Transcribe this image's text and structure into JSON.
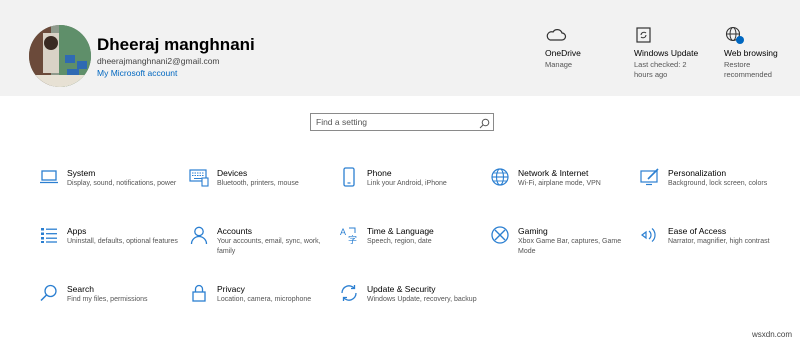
{
  "user": {
    "name": "Dheeraj manghnani",
    "email": "dheerajmanghnani2@gmail.com",
    "account_link": "My Microsoft account"
  },
  "status": [
    {
      "icon": "cloud-icon",
      "title": "OneDrive",
      "sub": "Manage"
    },
    {
      "icon": "windows-update-icon",
      "title": "Windows Update",
      "sub": "Last checked: 2 hours ago"
    },
    {
      "icon": "globe-icon",
      "title": "Web browsing",
      "sub": "Restore recommended"
    }
  ],
  "search": {
    "placeholder": "Find a setting"
  },
  "tiles": [
    {
      "icon": "laptop-icon",
      "title": "System",
      "desc": "Display, sound, notifications, power"
    },
    {
      "icon": "keyboard-icon",
      "title": "Devices",
      "desc": "Bluetooth, printers, mouse"
    },
    {
      "icon": "phone-icon",
      "title": "Phone",
      "desc": "Link your Android, iPhone"
    },
    {
      "icon": "globe-icon",
      "title": "Network & Internet",
      "desc": "Wi-Fi, airplane mode, VPN"
    },
    {
      "icon": "personalization-icon",
      "title": "Personalization",
      "desc": "Background, lock screen, colors"
    },
    {
      "icon": "apps-list-icon",
      "title": "Apps",
      "desc": "Uninstall, defaults, optional features"
    },
    {
      "icon": "person-icon",
      "title": "Accounts",
      "desc": "Your accounts, email, sync, work, family"
    },
    {
      "icon": "language-icon",
      "title": "Time & Language",
      "desc": "Speech, region, date"
    },
    {
      "icon": "xbox-icon",
      "title": "Gaming",
      "desc": "Xbox Game Bar, captures, Game Mode"
    },
    {
      "icon": "ease-of-access-icon",
      "title": "Ease of Access",
      "desc": "Narrator, magnifier, high contrast"
    },
    {
      "icon": "search-icon",
      "title": "Search",
      "desc": "Find my files, permissions"
    },
    {
      "icon": "lock-icon",
      "title": "Privacy",
      "desc": "Location, camera, microphone"
    },
    {
      "icon": "update-icon",
      "title": "Update & Security",
      "desc": "Windows Update, recovery, backup"
    }
  ],
  "watermark": "wsxdn.com",
  "colors": {
    "accent": "#0067c0",
    "icon_blue": "#2b7fd1",
    "header_bg": "#f2f2f2"
  }
}
